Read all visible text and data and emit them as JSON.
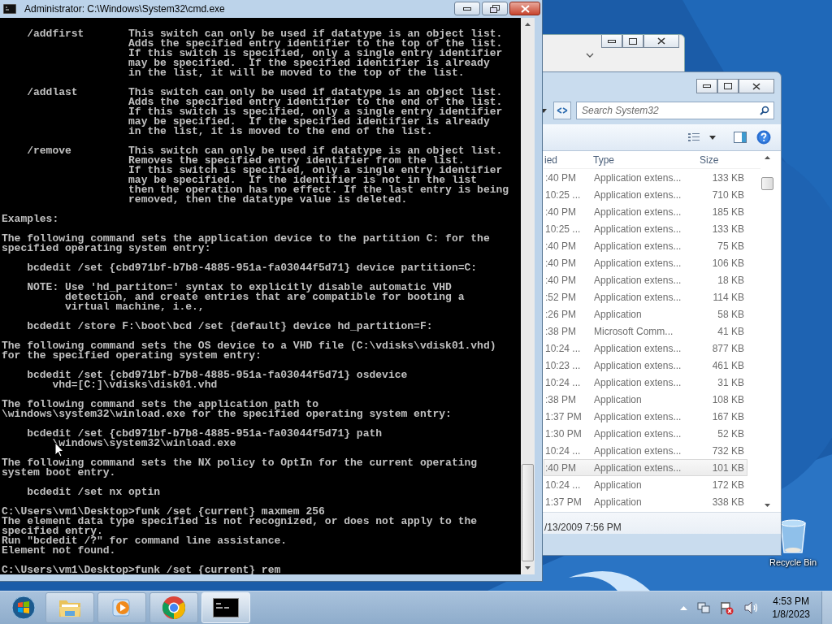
{
  "console_window": {
    "title": "Administrator: C:\\Windows\\System32\\cmd.exe",
    "blocks": [
      [
        "    /addfirst       This switch can only be used if datatype is an object list.",
        "                    Adds the specified entry identifier to the top of the list.",
        "                    If this switch is specified, only a single entry identifier",
        "                    may be specified.  If the specified identifier is already",
        "                    in the list, it will be moved to the top of the list."
      ],
      [
        "    /addlast        This switch can only be used if datatype is an object list.",
        "                    Adds the specified entry identifier to the end of the list.",
        "                    If this switch is specified, only a single entry identifier",
        "                    may be specified.  If the specified identifier is already",
        "                    in the list, it is moved to the end of the list."
      ],
      [
        "    /remove         This switch can only be used if datatype is an object list.",
        "                    Removes the specified entry identifier from the list.",
        "                    If this switch is specified, only a single entry identifier",
        "                    may be specified.  If the identifier is not in the list",
        "                    then the operation has no effect. If the last entry is being",
        "                    removed, then the datatype value is deleted."
      ],
      [
        "Examples:"
      ],
      [
        "The following command sets the application device to the partition C: for the",
        "specified operating system entry:"
      ],
      [
        "    bcdedit /set {cbd971bf-b7b8-4885-951a-fa03044f5d71} device partition=C:"
      ],
      [
        "    NOTE: Use 'hd_partiton=' syntax to explicitly disable automatic VHD",
        "          detection, and create entries that are compatible for booting a",
        "          virtual machine, i.e.,"
      ],
      [
        "    bcdedit /store F:\\boot\\bcd /set {default} device hd_partition=F:"
      ],
      [
        "The following command sets the OS device to a VHD file (C:\\vdisks\\vdisk01.vhd)",
        "for the specified operating system entry:"
      ],
      [
        "    bcdedit /set {cbd971bf-b7b8-4885-951a-fa03044f5d71} osdevice",
        "        vhd=[C:]\\vdisks\\disk01.vhd"
      ],
      [
        "The following command sets the application path to",
        "\\windows\\system32\\winload.exe for the specified operating system entry:"
      ],
      [
        "    bcdedit /set {cbd971bf-b7b8-4885-951a-fa03044f5d71} path",
        "        \\windows\\system32\\winload.exe"
      ],
      [
        "The following command sets the NX policy to OptIn for the current operating",
        "system boot entry."
      ],
      [
        "    bcdedit /set nx optin"
      ],
      [
        "C:\\Users\\vm1\\Desktop>funk /set {current} maxmem 256",
        "The element data type specified is not recognized, or does not apply to the",
        "specified entry.",
        "Run \"bcdedit /?\" for command line assistance.",
        "Element not found."
      ],
      [
        "C:\\Users\\vm1\\Desktop>funk /set {current} rem"
      ]
    ]
  },
  "explorer_window": {
    "search": {
      "placeholder": "Search System32"
    },
    "columns": [
      "ied",
      "Type",
      "Size"
    ],
    "rows": [
      {
        "modified": ":40 PM",
        "type": "Application extens...",
        "size": "133 KB",
        "selected": false
      },
      {
        "modified": "10:25 ...",
        "type": "Application extens...",
        "size": "710 KB",
        "selected": false
      },
      {
        "modified": ":40 PM",
        "type": "Application extens...",
        "size": "185 KB",
        "selected": false
      },
      {
        "modified": "10:25 ...",
        "type": "Application extens...",
        "size": "133 KB",
        "selected": false
      },
      {
        "modified": ":40 PM",
        "type": "Application extens...",
        "size": "75 KB",
        "selected": false
      },
      {
        "modified": ":40 PM",
        "type": "Application extens...",
        "size": "106 KB",
        "selected": false
      },
      {
        "modified": ":40 PM",
        "type": "Application extens...",
        "size": "18 KB",
        "selected": false
      },
      {
        "modified": ":52 PM",
        "type": "Application extens...",
        "size": "114 KB",
        "selected": false
      },
      {
        "modified": ":26 PM",
        "type": "Application",
        "size": "58 KB",
        "selected": false
      },
      {
        "modified": ":38 PM",
        "type": "Microsoft Comm...",
        "size": "41 KB",
        "selected": false
      },
      {
        "modified": "10:24 ...",
        "type": "Application extens...",
        "size": "877 KB",
        "selected": false
      },
      {
        "modified": "10:23 ...",
        "type": "Application extens...",
        "size": "461 KB",
        "selected": false
      },
      {
        "modified": "10:24 ...",
        "type": "Application extens...",
        "size": "31 KB",
        "selected": false
      },
      {
        "modified": ":38 PM",
        "type": "Application",
        "size": "108 KB",
        "selected": false
      },
      {
        "modified": "1:37 PM",
        "type": "Application extens...",
        "size": "167 KB",
        "selected": false
      },
      {
        "modified": "1:30 PM",
        "type": "Application extens...",
        "size": "52 KB",
        "selected": false
      },
      {
        "modified": "10:24 ...",
        "type": "Application extens...",
        "size": "732 KB",
        "selected": false
      },
      {
        "modified": ":40 PM",
        "type": "Application extens...",
        "size": "101 KB",
        "selected": true
      },
      {
        "modified": "10:24 ...",
        "type": "Application",
        "size": "172 KB",
        "selected": false
      },
      {
        "modified": "1:37 PM",
        "type": "Application",
        "size": "338 KB",
        "selected": false
      }
    ],
    "details": "/13/2009 7:56 PM"
  },
  "desktop_icons": [
    {
      "label": "Recycle Bin"
    }
  ],
  "taskbar": {
    "apps": [
      {
        "kind": "explorer",
        "active": false
      },
      {
        "kind": "media",
        "active": false
      },
      {
        "kind": "chrome",
        "active": false
      },
      {
        "kind": "console",
        "active": true
      }
    ],
    "clock": {
      "time": "4:53 PM",
      "date": "1/8/2023"
    }
  }
}
